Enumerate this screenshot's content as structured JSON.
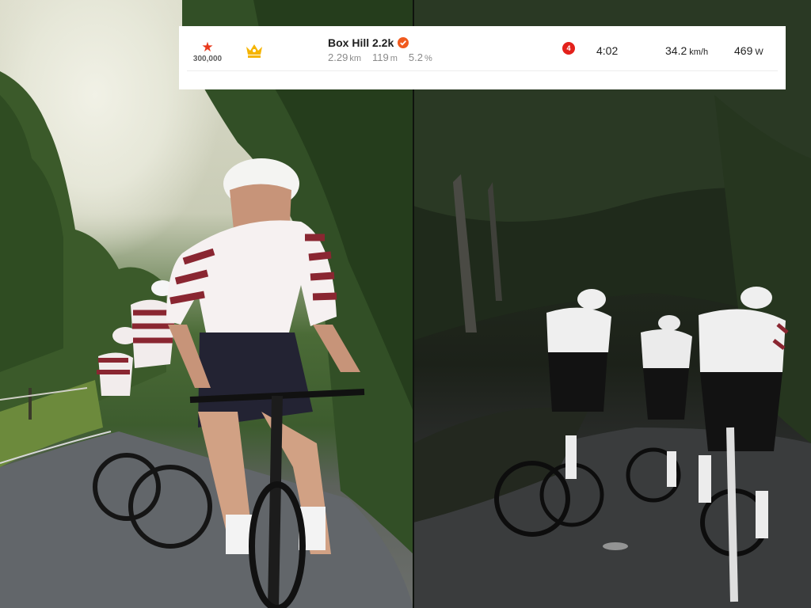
{
  "segment": {
    "kom_count": "300,000",
    "name": "Box Hill 2.2k",
    "distance_value": "2.29",
    "distance_unit": "km",
    "elevation_value": "119",
    "elevation_unit": "m",
    "grade_value": "5.2",
    "grade_unit": "%",
    "rank": "4",
    "time": "4:02",
    "speed_value": "34.2",
    "speed_unit": "km/h",
    "power_value": "469",
    "power_unit": "W"
  },
  "colors": {
    "star": "#e8391c",
    "crown": "#f5b400",
    "verified_badge": "#f05a1e",
    "rank_badge": "#e3211b"
  },
  "icons": {
    "kom": "star-icon",
    "crown": "crown-icon",
    "verified": "verified-badge-icon"
  }
}
